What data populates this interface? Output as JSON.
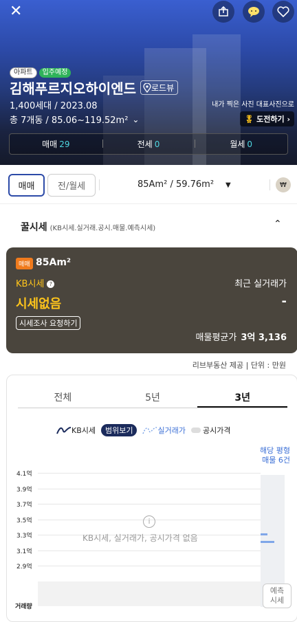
{
  "header": {
    "icons": {
      "close": "close-icon",
      "share": "share-icon",
      "chat": "chat-icon",
      "favorite": "heart-icon"
    },
    "tags": {
      "type": "아파트",
      "status": "입주예정"
    },
    "complex_name": "김해푸르지오하이엔드",
    "road_view": "로드뷰",
    "households_year": "1,400세대 / 2023.08",
    "buildings_area": "총 7개동 / 85.06~119.52m²",
    "photo_note": "내가 찍은 사진 대표사진으로",
    "challenge": "도전하기",
    "counts": [
      {
        "label": "매매",
        "value": "29"
      },
      {
        "label": "전세",
        "value": "0"
      },
      {
        "label": "월세",
        "value": "0"
      }
    ]
  },
  "filters": {
    "tabs": [
      {
        "label": "매매"
      },
      {
        "label": "전/월세"
      }
    ],
    "area": "85Am² / 59.76m²"
  },
  "section": {
    "title": "꿀시세",
    "subtitle": "(KB시세.실거래.공시.매물.예측시세)"
  },
  "price_card": {
    "badge": "매매",
    "area": "85Am²",
    "kb_label": "KB시세",
    "recent_label": "최근 실거래가",
    "kb_value": "시세없음",
    "recent_value": "-",
    "request_button": "시세조사 요청하기",
    "avg_label": "매물평균가",
    "avg_value": "3억 3,136"
  },
  "provider": "리브부동산 제공  |  단위 : 만원",
  "chart": {
    "period_tabs": [
      "전체",
      "5년",
      "3년"
    ],
    "legend": {
      "kb": "KB시세",
      "range": "범위보기",
      "real": "실거래가",
      "public": "공시가격"
    },
    "listing_count": [
      "해당 평형",
      "매물 6건"
    ],
    "empty_message": "KB시세, 실거래가, 공시가격 없음",
    "volume_label": "거래량",
    "predict_button": [
      "예측",
      "시세"
    ]
  },
  "chart_data": {
    "type": "line",
    "title": "",
    "ylabel": "",
    "y_ticks": [
      "4.1억",
      "3.9억",
      "3.7억",
      "3.5억",
      "3.3억",
      "3.1억",
      "2.9억"
    ],
    "ylim": [
      2.9,
      4.1
    ],
    "series": [],
    "colors": {
      "kb": "#1b2b5c",
      "real": "#7fa6e8",
      "listing": "#7fa6e8"
    }
  }
}
